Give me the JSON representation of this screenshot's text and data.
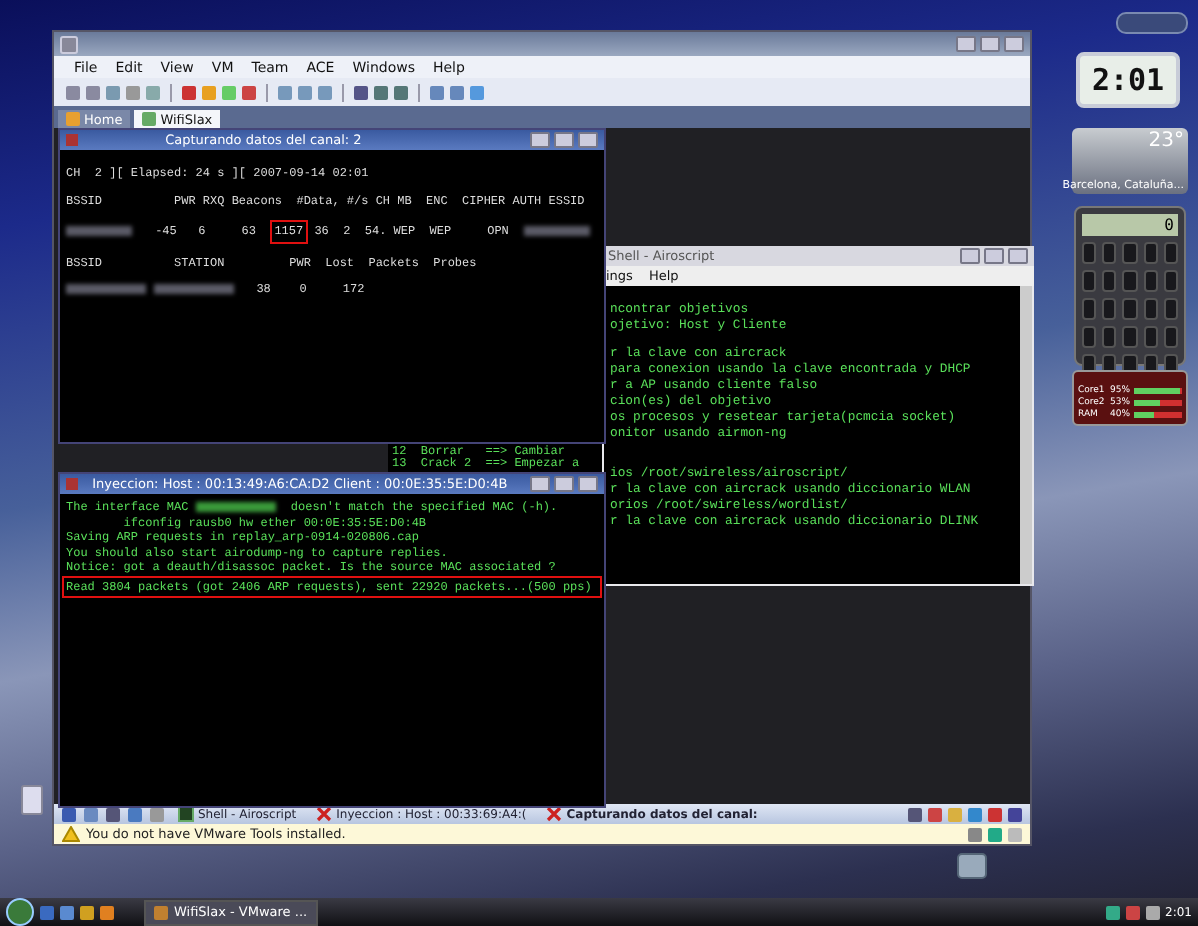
{
  "vm_window": {
    "menu": [
      "File",
      "Edit",
      "View",
      "VM",
      "Team",
      "ACE",
      "Windows",
      "Help"
    ],
    "tabs": [
      {
        "label": "Home",
        "selected": false
      },
      {
        "label": "WifiSlax",
        "selected": true
      }
    ],
    "capture_window": {
      "title": "Capturando datos del canal:  2",
      "lines": [
        {
          "kind": "line",
          "text": "CH  2 ][ Elapsed: 24 s ][ 2007-09-14 02:01"
        },
        {
          "kind": "gap"
        },
        {
          "kind": "line",
          "text": "BSSID          PWR RXQ Beacons  #Data, #/s CH MB  ENC  CIPHER AUTH ESSID"
        },
        {
          "kind": "gap"
        },
        {
          "kind": "mixed",
          "segments": [
            {
              "kind": "blurred"
            },
            {
              "kind": "text",
              "text": "  -45   6     63  "
            },
            {
              "kind": "boxed",
              "text": "1157"
            },
            {
              "kind": "text",
              "text": " 36  2  54. WEP  WEP     OPN  "
            },
            {
              "kind": "blurred"
            }
          ]
        },
        {
          "kind": "gap"
        },
        {
          "kind": "line",
          "text": "BSSID          STATION         PWR  Lost  Packets  Probes"
        },
        {
          "kind": "gap"
        },
        {
          "kind": "mixed",
          "segments": [
            {
              "kind": "blurred"
            },
            {
              "kind": "blurred"
            },
            {
              "kind": "text",
              "text": "  38    0     172"
            }
          ]
        }
      ]
    },
    "shell_window": {
      "title": "Shell - Airoscript",
      "menu": [
        "ings",
        "Help"
      ],
      "lines": [
        {
          "kind": "line",
          "text": "ncontrar objetivos"
        },
        {
          "kind": "line",
          "text": "ojetivo: Host y Cliente"
        },
        {
          "kind": "gap"
        },
        {
          "kind": "line",
          "text": "r la clave con aircrack"
        },
        {
          "kind": "line",
          "text": "para conexion usando la clave encontrada y DHCP"
        },
        {
          "kind": "line",
          "text": "r a AP usando cliente falso"
        },
        {
          "kind": "line",
          "text": "cion(es) del objetivo"
        },
        {
          "kind": "line",
          "text": "os procesos y resetear tarjeta(pcmcia socket)"
        },
        {
          "kind": "line",
          "text": "onitor usando airmon-ng"
        },
        {
          "kind": "gap"
        },
        {
          "kind": "gap"
        },
        {
          "kind": "line",
          "text": "ios /root/swireless/airoscript/"
        },
        {
          "kind": "line",
          "text": "r la clave con aircrack usando diccionario WLAN"
        },
        {
          "kind": "line",
          "text": "orios /root/swireless/wordlist/"
        },
        {
          "kind": "line",
          "text": "r la clave con aircrack usando diccionario DLINK"
        }
      ],
      "strip_lines": [
        "12  Borrar   ==> Cambiar",
        "13  Crack 2  ==> Empezar a"
      ]
    },
    "injection_window": {
      "title": "Inyeccion: Host : 00:13:49:A6:CA:D2 Client : 00:0E:35:5E:D0:4B",
      "lines": [
        {
          "kind": "mixed",
          "segments": [
            {
              "kind": "text",
              "text": "The interface MAC "
            },
            {
              "kind": "blurred"
            },
            {
              "kind": "text",
              "text": " doesn't match the specified MAC (-h)."
            }
          ]
        },
        {
          "kind": "line",
          "text": "        ifconfig rausb0 hw ether 00:0E:35:5E:D0:4B"
        },
        {
          "kind": "line",
          "text": "Saving ARP requests in replay_arp-0914-020806.cap"
        },
        {
          "kind": "line",
          "text": "You should also start airodump-ng to capture replies."
        },
        {
          "kind": "line",
          "text": "Notice: got a deauth/disassoc packet. Is the source MAC associated ?"
        },
        {
          "kind": "boxed",
          "text": "Read 3804 packets (got 2406 ARP requests), sent 22920 packets...(500 pps)"
        }
      ]
    },
    "guest_taskbar": {
      "tasks": [
        {
          "label": "Shell - Airoscript",
          "kind": "terminal",
          "selected": false
        },
        {
          "label": "Inyeccion : Host : 00:33:69:A4:(",
          "kind": "closed",
          "selected": false
        },
        {
          "label": "Capturando datos del canal:",
          "kind": "closed",
          "selected": true
        }
      ]
    },
    "status_message": "You do not have VMware Tools installed."
  },
  "gadgets": {
    "clock": "2:01",
    "weather": {
      "temperature": "23°",
      "location": "Barcelona, Cataluña..."
    },
    "calculator": {
      "display": "0"
    },
    "cpu_meter": {
      "rows": [
        {
          "label": "Core1",
          "reading": "95%",
          "level": 0.95
        },
        {
          "label": "Core2",
          "reading": "53%",
          "level": 0.53
        },
        {
          "label": "RAM",
          "reading": "40%",
          "level": 0.4
        }
      ]
    }
  },
  "taskbar": {
    "tasks": [
      {
        "label": "WifiSlax - VMware ...",
        "selected": true
      }
    ],
    "clock": "2:01"
  }
}
